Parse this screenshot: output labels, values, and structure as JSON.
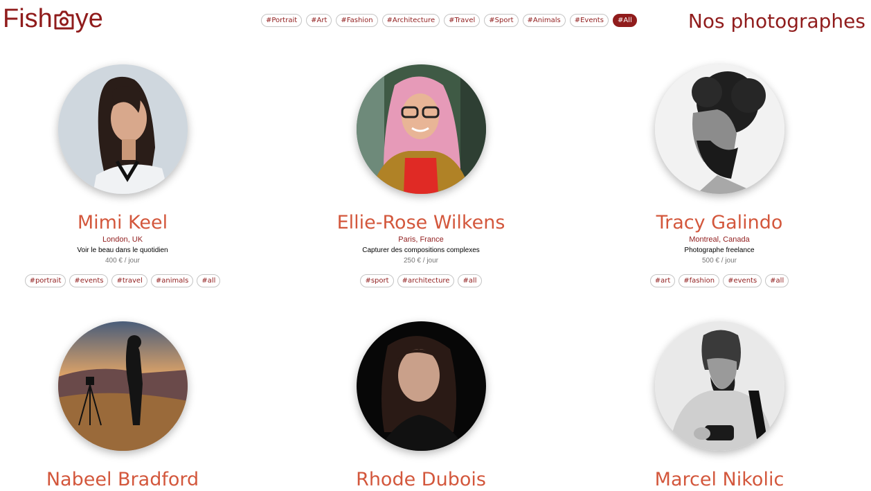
{
  "header": {
    "logo_left": "Fish",
    "logo_right": "ye",
    "heading": "Nos photographes",
    "nav_tags": [
      "#Portrait",
      "#Art",
      "#Fashion",
      "#Architecture",
      "#Travel",
      "#Sport",
      "#Animals",
      "#Events",
      "#All"
    ],
    "active_tag": "#All"
  },
  "colors": {
    "brand": "#901c1c",
    "name": "#d3573c",
    "price": "#757575"
  },
  "photographers": [
    {
      "name": "Mimi Keel",
      "location": "London, UK",
      "tagline": "Voir le beau dans le quotidien",
      "price": "400 € / jour",
      "tags": [
        "#portrait",
        "#events",
        "#travel",
        "#animals",
        "#all"
      ],
      "avatar_icon": "portrait-photo"
    },
    {
      "name": "Ellie-Rose Wilkens",
      "location": "Paris, France",
      "tagline": "Capturer des compositions complexes",
      "price": "250 € / jour",
      "tags": [
        "#sport",
        "#architecture",
        "#all"
      ],
      "avatar_icon": "portrait-photo"
    },
    {
      "name": "Tracy Galindo",
      "location": "Montreal, Canada",
      "tagline": "Photographe freelance",
      "price": "500 € / jour",
      "tags": [
        "#art",
        "#fashion",
        "#events",
        "#all"
      ],
      "avatar_icon": "portrait-photo"
    },
    {
      "name": "Nabeel Bradford",
      "avatar_icon": "portrait-photo"
    },
    {
      "name": "Rhode Dubois",
      "avatar_icon": "portrait-photo"
    },
    {
      "name": "Marcel Nikolic",
      "avatar_icon": "portrait-photo"
    }
  ]
}
